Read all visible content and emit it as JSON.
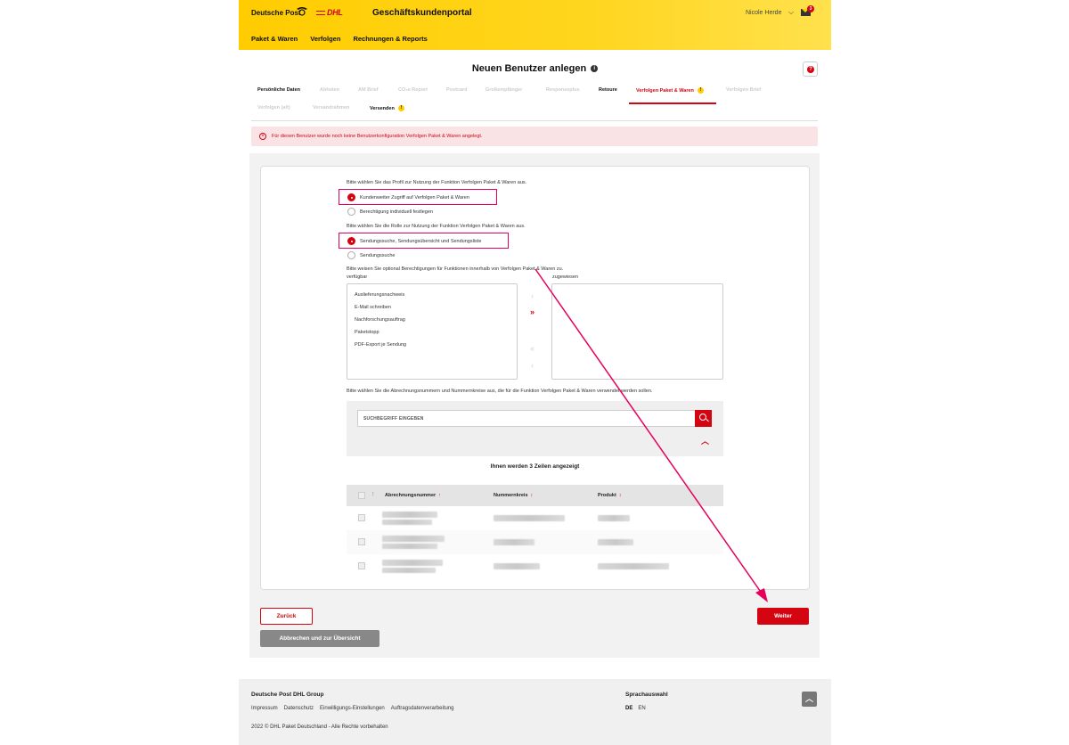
{
  "header": {
    "brand_dp": "Deutsche Post",
    "brand_dhl": "DHL",
    "portal_title": "Geschäftskundenportal",
    "user_name": "Nicole Herde",
    "mail_count": "3",
    "nav": [
      "Paket & Waren",
      "Verfolgen",
      "Rechnungen & Reports"
    ]
  },
  "page": {
    "title": "Neuen Benutzer anlegen"
  },
  "tabs": {
    "row1": [
      {
        "label": "Persönliche Daten"
      },
      {
        "label": "Abholen"
      },
      {
        "label": "AM Brief"
      },
      {
        "label": "CO₂e Report"
      },
      {
        "label": "Postcard"
      },
      {
        "label": "Großempfänger"
      },
      {
        "label": "Responseplus"
      },
      {
        "label": "Retoure"
      },
      {
        "label": "Verfolgen Paket & Waren"
      },
      {
        "label": "Verfolgen Brief"
      }
    ],
    "row2": [
      {
        "label": "Verfolgen (alt)"
      },
      {
        "label": "Versandrahmen"
      },
      {
        "label": "Versenden"
      }
    ]
  },
  "alert": {
    "text": "Für diesen Benutzer wurde noch keine Benutzerkonfiguration Verfolgen Paket & Waren angelegt."
  },
  "form": {
    "profile_question": "Bitte wählen Sie das Profil zur Nutzung der Funktion Verfolgen Paket & Waren aus.",
    "profile_options": [
      "Kundenweiter Zugriff auf Verfolgen Paket & Waren",
      "Berechtigung individuell festlegen"
    ],
    "role_question": "Bitte wählen Sie die Rolle zur Nutzung der Funktion Verfolgen Paket & Waren aus.",
    "role_options": [
      "Sendungssuche, Sendungsübersicht und Sendungsliste",
      "Sendungssuche"
    ],
    "permissions_question": "Bitte weisen Sie optional Berechtigungen für Funktionen innerhalb von Verfolgen Paket & Waren zu.",
    "available_label": "verfügbar",
    "assigned_label": "zugewiesen",
    "available_items": [
      "Auslieferungsnachweis",
      "E-Mail schreiben",
      "Nachforschungsauftrag",
      "Paketstopp",
      "PDF-Export je Sendung"
    ],
    "accounts_question": "Bitte wählen Sie die Abrechnungsnummern und Nummernkreise aus, die für die Funktion Verfolgen Paket & Waren verwendet werden sollen.",
    "search_placeholder": "SUCHBEGRIFF EINGEBEN",
    "rows_count": "Ihnen werden 3 Zeilen angezeigt",
    "columns": [
      "Abrechnungsnummer",
      "Nummernkreis",
      "Produkt"
    ]
  },
  "buttons": {
    "back": "Zurück",
    "next": "Weiter",
    "cancel": "Abbrechen und zur Übersicht"
  },
  "footer": {
    "brand": "Deutsche Post DHL Group",
    "links": [
      "Impressum",
      "Datenschutz",
      "Einwilligungs-Einstellungen",
      "Auftragsdatenverarbeitung"
    ],
    "copyright": "2022 © DHL Paket Deutschland - Alle Rechte vorbehalten",
    "language_title": "Sprachauswahl",
    "languages": [
      "DE",
      "EN"
    ]
  },
  "colors": {
    "brand_yellow": "#ffcc00",
    "brand_red": "#d40511",
    "annotation_pink": "#e6005c"
  }
}
